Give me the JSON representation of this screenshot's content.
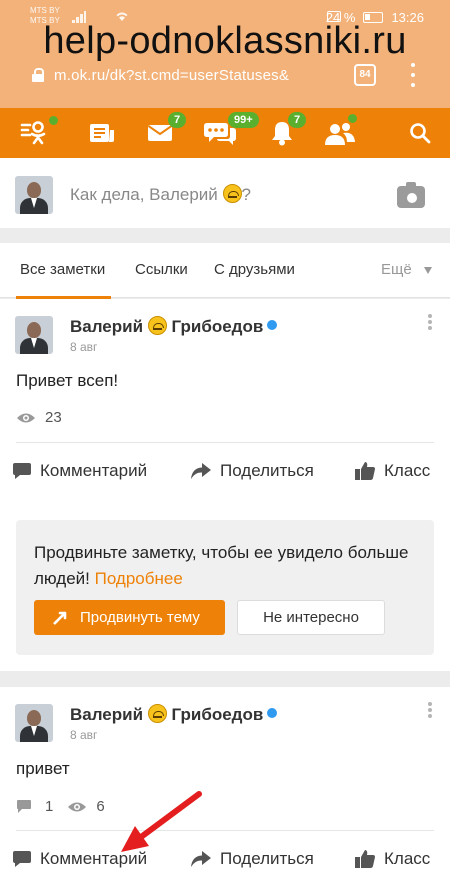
{
  "status_bar": {
    "carrier_1": "MTS BY",
    "carrier_2": "MTS BY",
    "battery_percent": "24 %",
    "time": "13:26"
  },
  "browser": {
    "url": "m.ok.ru/dk?st.cmd=userStatuses&",
    "tabs_count": "84"
  },
  "watermark": "help-odnoklassniki.ru",
  "nav": {
    "messages_badge": "7",
    "discussions_badge": "99+",
    "notifications_badge": "7"
  },
  "compose": {
    "placeholder_start": "Как дела, Валерий",
    "placeholder_end": "?"
  },
  "tabs": {
    "items": [
      "Все заметки",
      "Ссылки",
      "С друзьями"
    ],
    "more": "Ещё"
  },
  "posts": [
    {
      "author": "Валерий",
      "author_last": "Грибоедов",
      "date": "8 авг",
      "text": "Привет всеп!",
      "views": "23"
    },
    {
      "author": "Валерий",
      "author_last": "Грибоедов",
      "date": "8 авг",
      "text": "привет",
      "comments": "1",
      "views": "6"
    }
  ],
  "actions": {
    "comment": "Комментарий",
    "share": "Поделиться",
    "like": "Класс"
  },
  "promo": {
    "text": "Продвиньте заметку, чтобы ее увидело больше людей!",
    "link": "Подробнее",
    "primary_button": "Продвинуть тему",
    "secondary_button": "Не интересно"
  },
  "colors": {
    "accent": "#ee8208",
    "badge": "#5ab02e",
    "annotation_arrow": "#e41e1e"
  }
}
